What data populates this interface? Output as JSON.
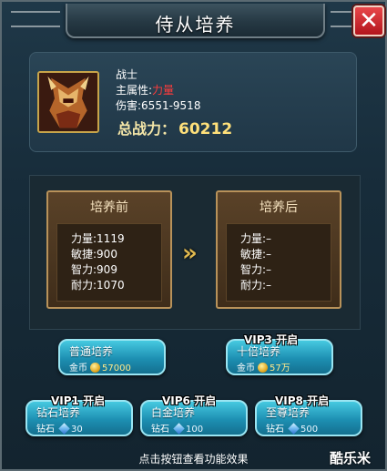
{
  "title": "侍从培养",
  "close_icon": "close-icon",
  "hero": {
    "class": "战士",
    "main_attr_label": "主属性:",
    "main_attr_value": "力量",
    "damage": "伤害:6551-9518",
    "power_label": "总战力：",
    "power_value": "60212"
  },
  "before": {
    "title": "培养前",
    "stats": [
      "力量:1119",
      "敏捷:900",
      "智力:909",
      "耐力:1070"
    ]
  },
  "after": {
    "title": "培养后",
    "stats": [
      "力量:–",
      "敏捷:–",
      "智力:–",
      "耐力:–"
    ]
  },
  "arrow": "»",
  "buttons": {
    "normal": {
      "name": "普通培养",
      "cost_label": "金币",
      "cost_value": "57000",
      "currency_icon": "gold-coin-icon"
    },
    "tenfold": {
      "vip": "VIP3 开启",
      "name": "十倍培养",
      "cost_label": "金币",
      "cost_value": "57万",
      "currency_icon": "gold-coin-icon"
    },
    "diamond": {
      "vip": "VIP1 开启",
      "name": "钻石培养",
      "cost_label": "钻石",
      "cost_value": "30",
      "currency_icon": "diamond-icon"
    },
    "platinum": {
      "vip": "VIP6 开启",
      "name": "白金培养",
      "cost_label": "钻石",
      "cost_value": "100",
      "currency_icon": "diamond-icon"
    },
    "supreme": {
      "vip": "VIP8 开启",
      "name": "至尊培养",
      "cost_label": "钻石",
      "cost_value": "500",
      "currency_icon": "diamond-icon"
    }
  },
  "footer": "点击按钮查看功能效果",
  "watermark": "酷乐米"
}
